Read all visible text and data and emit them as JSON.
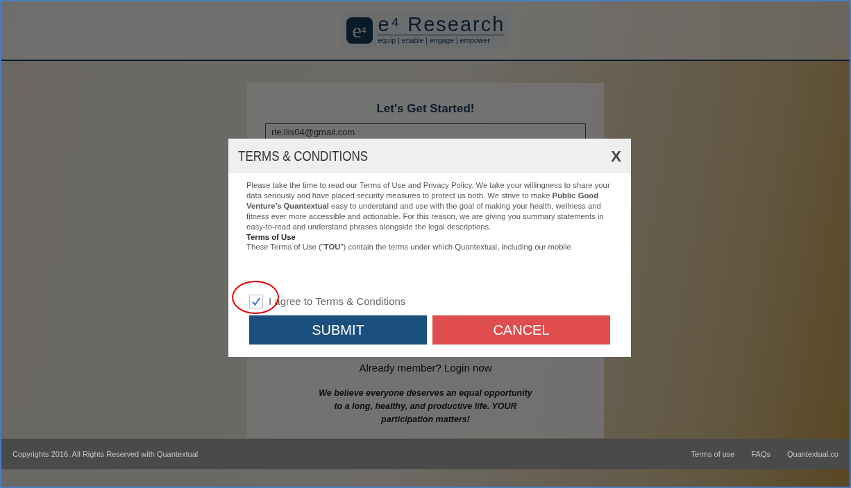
{
  "header": {
    "logo_mark": "e",
    "logo_sup": "4",
    "logo_title": "e⁴ Research",
    "logo_tagline": "equip | enable | engage | empower"
  },
  "signup": {
    "title": "Let's Get Started!",
    "email": {
      "value": "rle.llis04@gmail.com"
    },
    "login_prompt": "Already member? Login now",
    "tagline": "We believe everyone deserves an equal opportunity to a long, healthy, and productive life. YOUR participation matters!"
  },
  "modal": {
    "title": "TERMS & CONDITIONS",
    "close": "X",
    "paragraphs": [
      {
        "kind": "text",
        "text": "Please take the time to read our Terms of Use and Privacy Policy. We take your willingness to share your data seriously and have placed security measures to protect us both. We strive to make **Public Good Venture’s Quantextual** easy to understand and use with the goal of making your health, wellness and fitness ever more accessible and actionable. For this reason, we are giving you summary statements in easy-to-read and understand phrases alongside the legal descriptions."
      },
      {
        "kind": "heading",
        "text": "Terms of Use"
      },
      {
        "kind": "text",
        "text": "These Terms of Use (\"**TOU**\") contain the terms under which Quantextual, including our mobile"
      }
    ],
    "agree": {
      "label": "I agree to Terms & Conditions",
      "checked": true
    },
    "buttons": [
      {
        "label": "SUBMIT",
        "kind": "primary"
      },
      {
        "label": "CANCEL",
        "kind": "danger"
      }
    ]
  },
  "footer": {
    "copyright": "Copyrights 2016. All Rights Reserved with Quantextual",
    "links": [
      "Terms of use",
      "FAQs",
      "Quantextual.co"
    ]
  }
}
